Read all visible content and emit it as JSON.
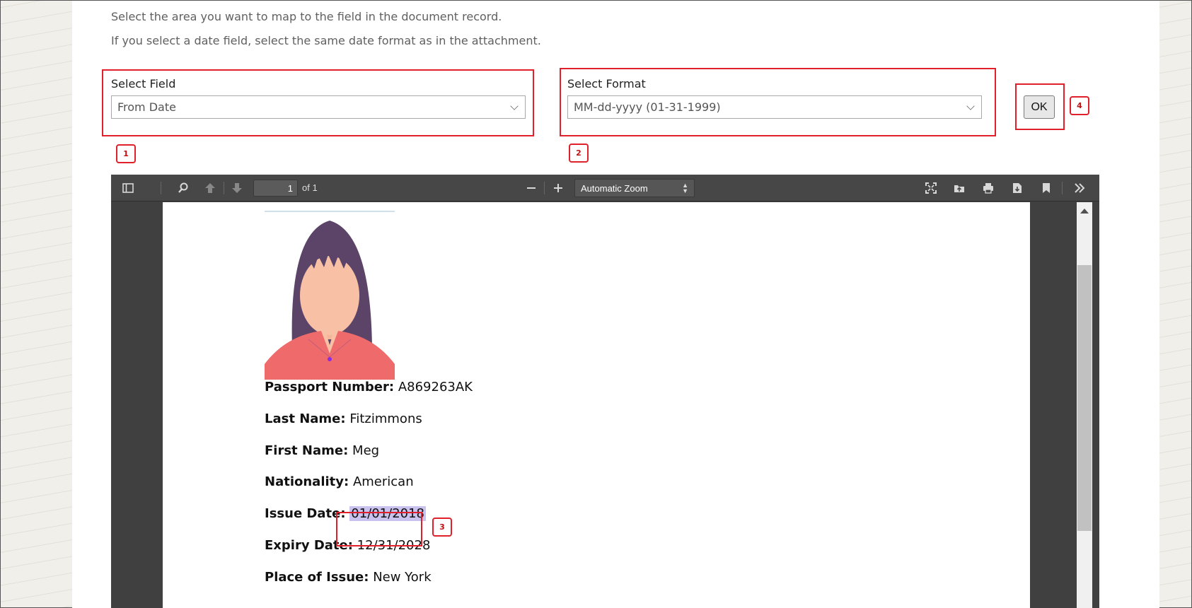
{
  "instructions": {
    "line1": "Select the area you want to map to the field in the document record.",
    "line2": "If you select a date field, select the same date format as in the attachment."
  },
  "select_field": {
    "label": "Select Field",
    "value": "From Date"
  },
  "select_format": {
    "label": "Select Format",
    "value": "MM-dd-yyyy (01-31-1999)"
  },
  "ok_button": {
    "label": "OK"
  },
  "markers": {
    "m1": "1",
    "m2": "2",
    "m3": "3",
    "m4": "4"
  },
  "viewer": {
    "page_number": "1",
    "page_of": "of 1",
    "zoom": "Automatic Zoom",
    "icons": [
      "sidebar-toggle-icon",
      "search-icon",
      "previous-page-icon",
      "next-page-icon",
      "zoom-out-icon",
      "zoom-in-icon",
      "presentation-mode-icon",
      "open-file-icon",
      "print-icon",
      "download-icon",
      "bookmark-icon",
      "tools-menu-icon"
    ]
  },
  "document": {
    "passport_number": {
      "label": "Passport Number:",
      "value": "A869263AK"
    },
    "last_name": {
      "label": "Last Name:",
      "value": "Fitzimmons"
    },
    "first_name": {
      "label": "First Name:",
      "value": "Meg"
    },
    "nationality": {
      "label": "Nationality:",
      "value": "American"
    },
    "issue_date": {
      "label": "Issue Date:",
      "value": "01/01/2018"
    },
    "expiry_date": {
      "label": "Expiry Date:",
      "value": "12/31/2028"
    },
    "place_of_issue": {
      "label": "Place of Issue:",
      "value": "New York"
    }
  },
  "colors": {
    "callout": "#e0202a",
    "highlight": "#c9c2ee",
    "toolbar": "#474747"
  }
}
